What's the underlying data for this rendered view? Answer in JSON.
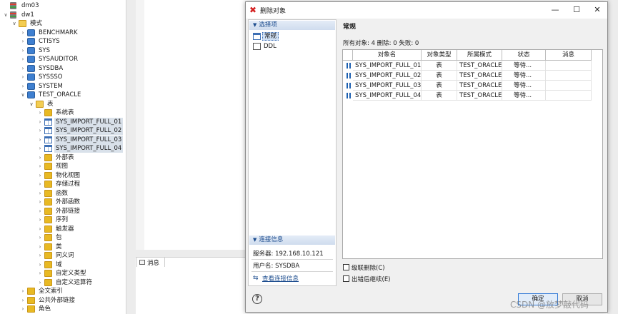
{
  "tree": {
    "nodes": [
      {
        "label": "dm03",
        "toggle": "",
        "icon": "db"
      },
      {
        "label": "dw1",
        "toggle": "∨",
        "icon": "db"
      },
      {
        "label": "模式",
        "toggle": "∨",
        "icon": "folder-open"
      },
      {
        "label": "BENCHMARK",
        "toggle": "›",
        "icon": "schema"
      },
      {
        "label": "CTISYS",
        "toggle": "›",
        "icon": "schema"
      },
      {
        "label": "SYS",
        "toggle": "›",
        "icon": "schema"
      },
      {
        "label": "SYSAUDITOR",
        "toggle": "›",
        "icon": "schema"
      },
      {
        "label": "SYSDBA",
        "toggle": "›",
        "icon": "schema"
      },
      {
        "label": "SYSSSO",
        "toggle": "›",
        "icon": "schema"
      },
      {
        "label": "SYSTEM",
        "toggle": "›",
        "icon": "schema"
      },
      {
        "label": "TEST_ORACLE",
        "toggle": "∨",
        "icon": "schema"
      },
      {
        "label": "表",
        "toggle": "∨",
        "icon": "folder-open"
      },
      {
        "label": "系统表",
        "toggle": "›",
        "icon": "folder"
      },
      {
        "label": "SYS_IMPORT_FULL_01",
        "toggle": "›",
        "icon": "table"
      },
      {
        "label": "SYS_IMPORT_FULL_02",
        "toggle": "›",
        "icon": "table"
      },
      {
        "label": "SYS_IMPORT_FULL_03",
        "toggle": "›",
        "icon": "table"
      },
      {
        "label": "SYS_IMPORT_FULL_04",
        "toggle": "›",
        "icon": "table"
      },
      {
        "label": "外部表",
        "toggle": "›",
        "icon": "folder"
      },
      {
        "label": "视图",
        "toggle": "›",
        "icon": "folder"
      },
      {
        "label": "物化视图",
        "toggle": "›",
        "icon": "folder"
      },
      {
        "label": "存储过程",
        "toggle": "›",
        "icon": "folder"
      },
      {
        "label": "函数",
        "toggle": "›",
        "icon": "folder"
      },
      {
        "label": "外部函数",
        "toggle": "›",
        "icon": "folder"
      },
      {
        "label": "外部链接",
        "toggle": "›",
        "icon": "folder"
      },
      {
        "label": "序列",
        "toggle": "›",
        "icon": "folder"
      },
      {
        "label": "触发器",
        "toggle": "›",
        "icon": "folder"
      },
      {
        "label": "包",
        "toggle": "›",
        "icon": "folder"
      },
      {
        "label": "类",
        "toggle": "›",
        "icon": "folder"
      },
      {
        "label": "同义词",
        "toggle": "›",
        "icon": "folder"
      },
      {
        "label": "域",
        "toggle": "›",
        "icon": "folder"
      },
      {
        "label": "自定义类型",
        "toggle": "›",
        "icon": "folder"
      },
      {
        "label": "自定义运算符",
        "toggle": "›",
        "icon": "folder"
      },
      {
        "label": "全文索引",
        "toggle": "›",
        "icon": "folder"
      },
      {
        "label": "公共外部链接",
        "toggle": "›",
        "icon": "folder"
      },
      {
        "label": "角色",
        "toggle": "›",
        "icon": "folder"
      }
    ]
  },
  "message_tab": {
    "label": "消息"
  },
  "dialog": {
    "title": "删除对象",
    "controls": {
      "minimize": "—",
      "maximize": "☐",
      "close": "✕"
    },
    "left": {
      "options_header": "选择项",
      "options": [
        "常规",
        "DDL"
      ],
      "connection_header": "连接信息",
      "server": "服务器: 192.168.10.121",
      "user": "用户名: SYSDBA",
      "view_link": "查看连接信息"
    },
    "right": {
      "section_title": "常规",
      "summary": "所有对象: 4 删除: 0 失败: 0",
      "columns": [
        "对象名",
        "对象类型",
        "所属模式",
        "状态",
        "消息"
      ],
      "rows": [
        {
          "name": "SYS_IMPORT_FULL_01",
          "type": "表",
          "schema": "TEST_ORACLE",
          "status": "等待...",
          "message": ""
        },
        {
          "name": "SYS_IMPORT_FULL_02",
          "type": "表",
          "schema": "TEST_ORACLE",
          "status": "等待...",
          "message": ""
        },
        {
          "name": "SYS_IMPORT_FULL_03",
          "type": "表",
          "schema": "TEST_ORACLE",
          "status": "等待...",
          "message": ""
        },
        {
          "name": "SYS_IMPORT_FULL_04",
          "type": "表",
          "schema": "TEST_ORACLE",
          "status": "等待...",
          "message": ""
        }
      ],
      "cascade_label": "级联删除(C)",
      "continue_label": "出错后继续(E)"
    },
    "buttons": {
      "help": "?",
      "ok": "确定",
      "cancel": "取消"
    }
  },
  "watermark": "CSDN @放梦敲代码"
}
